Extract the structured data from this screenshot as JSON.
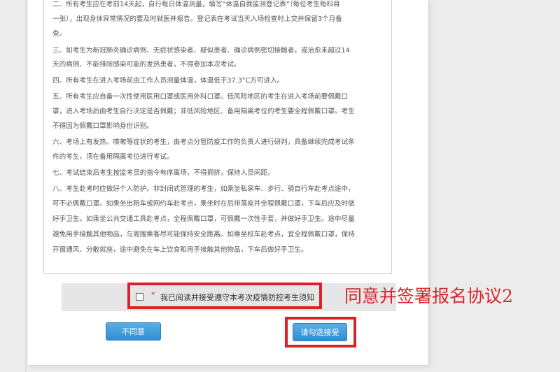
{
  "notice": {
    "lines": [
      "二、所有考生应在考前14天起，自行每日体温测量，填写“体温自我监测登记表”（每位考生每科目",
      "一张），出现身体异常情况的要及时就医并报告。登记表在考试当天入场检查时上交并保留3个月备",
      "查。",
      "三、如考生为新冠肺炎确诊病例、无症状感染者、疑似患者、确诊病例密切接触者，或治愈未超过14",
      "天的病例、不能排除感染可能的发热患者，不得参加本次考试。",
      "四、所有考生在进入考场前由工作人员测量体温，体温低于37.3°C方可进入。",
      "五、所有考生应自备一次性使用医用口罩或医用外科口罩。低风险地区的考生在进入考场前要佩戴口",
      "罩，进入考场后由考生自行决定是否佩戴；非低风险地区、备用隔离考位的考生要全程佩戴口罩。考生",
      "不得因为佩戴口罩影响身份识别。",
      "六、考场上有发热、咳嗽等症状的考生，由考点分管防疫工作的负责人进行研判，具备继续完成考试条",
      "件的考生，须在备用隔离考位进行考试。",
      "七、考试结束后考生按监考员的指令有序离场，不得拥挤，保持人员间距。",
      "八、考生赴考时应做好个人防护。非封闭式管理的考生，如乘坐私家车、步行、骑自行车赴考点途中，",
      "可不必佩戴口罩。如乘坐出租车或网约车赴考点，乘坐时在后排落座并全程佩戴口罩，下车后应及时做",
      "好手卫生。如乘坐公共交通工具赴考点，全程佩戴口罩，可佩戴一次性手套，并做好手卫生。途中尽量",
      "避免用手接触其他物品，与周围乘客尽可能保持安全距离。如乘坐校车赴考点，宜全程佩戴口罩，保持",
      "开窗通风、分散就座，途中避免在车上饮食和用手接触其他物品，下车后做好手卫生。"
    ]
  },
  "agreement": {
    "required_mark": "*",
    "label": "我已阅读并接受遵守本考次疫情防控考生须知"
  },
  "annotation": {
    "text": "同意并签署报名协议2",
    "color": "#d8232a"
  },
  "buttons": {
    "disagree": "不同意",
    "accept": "请勾选接受"
  },
  "colors": {
    "button_blue": "#3d9be0",
    "highlight_red": "#d8232a"
  }
}
